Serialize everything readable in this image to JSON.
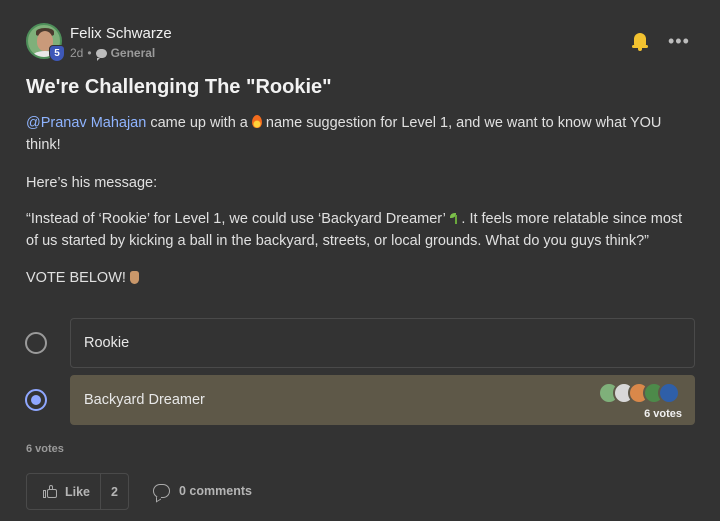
{
  "post": {
    "author": "Felix Schwarze",
    "level": "5",
    "time": "2d",
    "separator": "•",
    "category": "General",
    "title": "We're Challenging The \"Rookie\"",
    "p1_mention": "@Pranav Mahajan",
    "p1_a": " came up with a ",
    "p1_b": " name suggestion for Level 1, and we want to know what YOU think!",
    "p2": "Here’s his message:",
    "p3_a": "“Instead of ‘Rookie’ for Level 1, we could use ‘Backyard Dreamer’ ",
    "p3_b": ". It feels more relatable since most of us started by kicking a ball in the backyard, streets, or local grounds. What do you guys think?”",
    "p4": "VOTE BELOW! "
  },
  "poll": {
    "options": [
      {
        "label": "Rookie",
        "selected": false
      },
      {
        "label": "Backyard Dreamer",
        "selected": true,
        "votes": "6 votes"
      }
    ],
    "total": "6 votes",
    "voter_colors": [
      "#7fb07a",
      "#d8d8d8",
      "#d9884a",
      "#4d8a4a",
      "#2f5fa8"
    ]
  },
  "actions": {
    "like_label": "Like",
    "like_count": "2",
    "comments_label": "0 comments"
  },
  "colors": {
    "background": "#333333",
    "mention": "#8fb4ff",
    "selected_option": "#5e5848",
    "radio_selected": "#8fa7ff",
    "bell": "#f2c230",
    "level_badge": "#3e58b8"
  },
  "icons": [
    "bell-icon",
    "more-icon",
    "chat-icon",
    "fire-emoji",
    "sprout-emoji",
    "pointing-down-emoji",
    "thumbs-up-icon",
    "comment-icon"
  ]
}
